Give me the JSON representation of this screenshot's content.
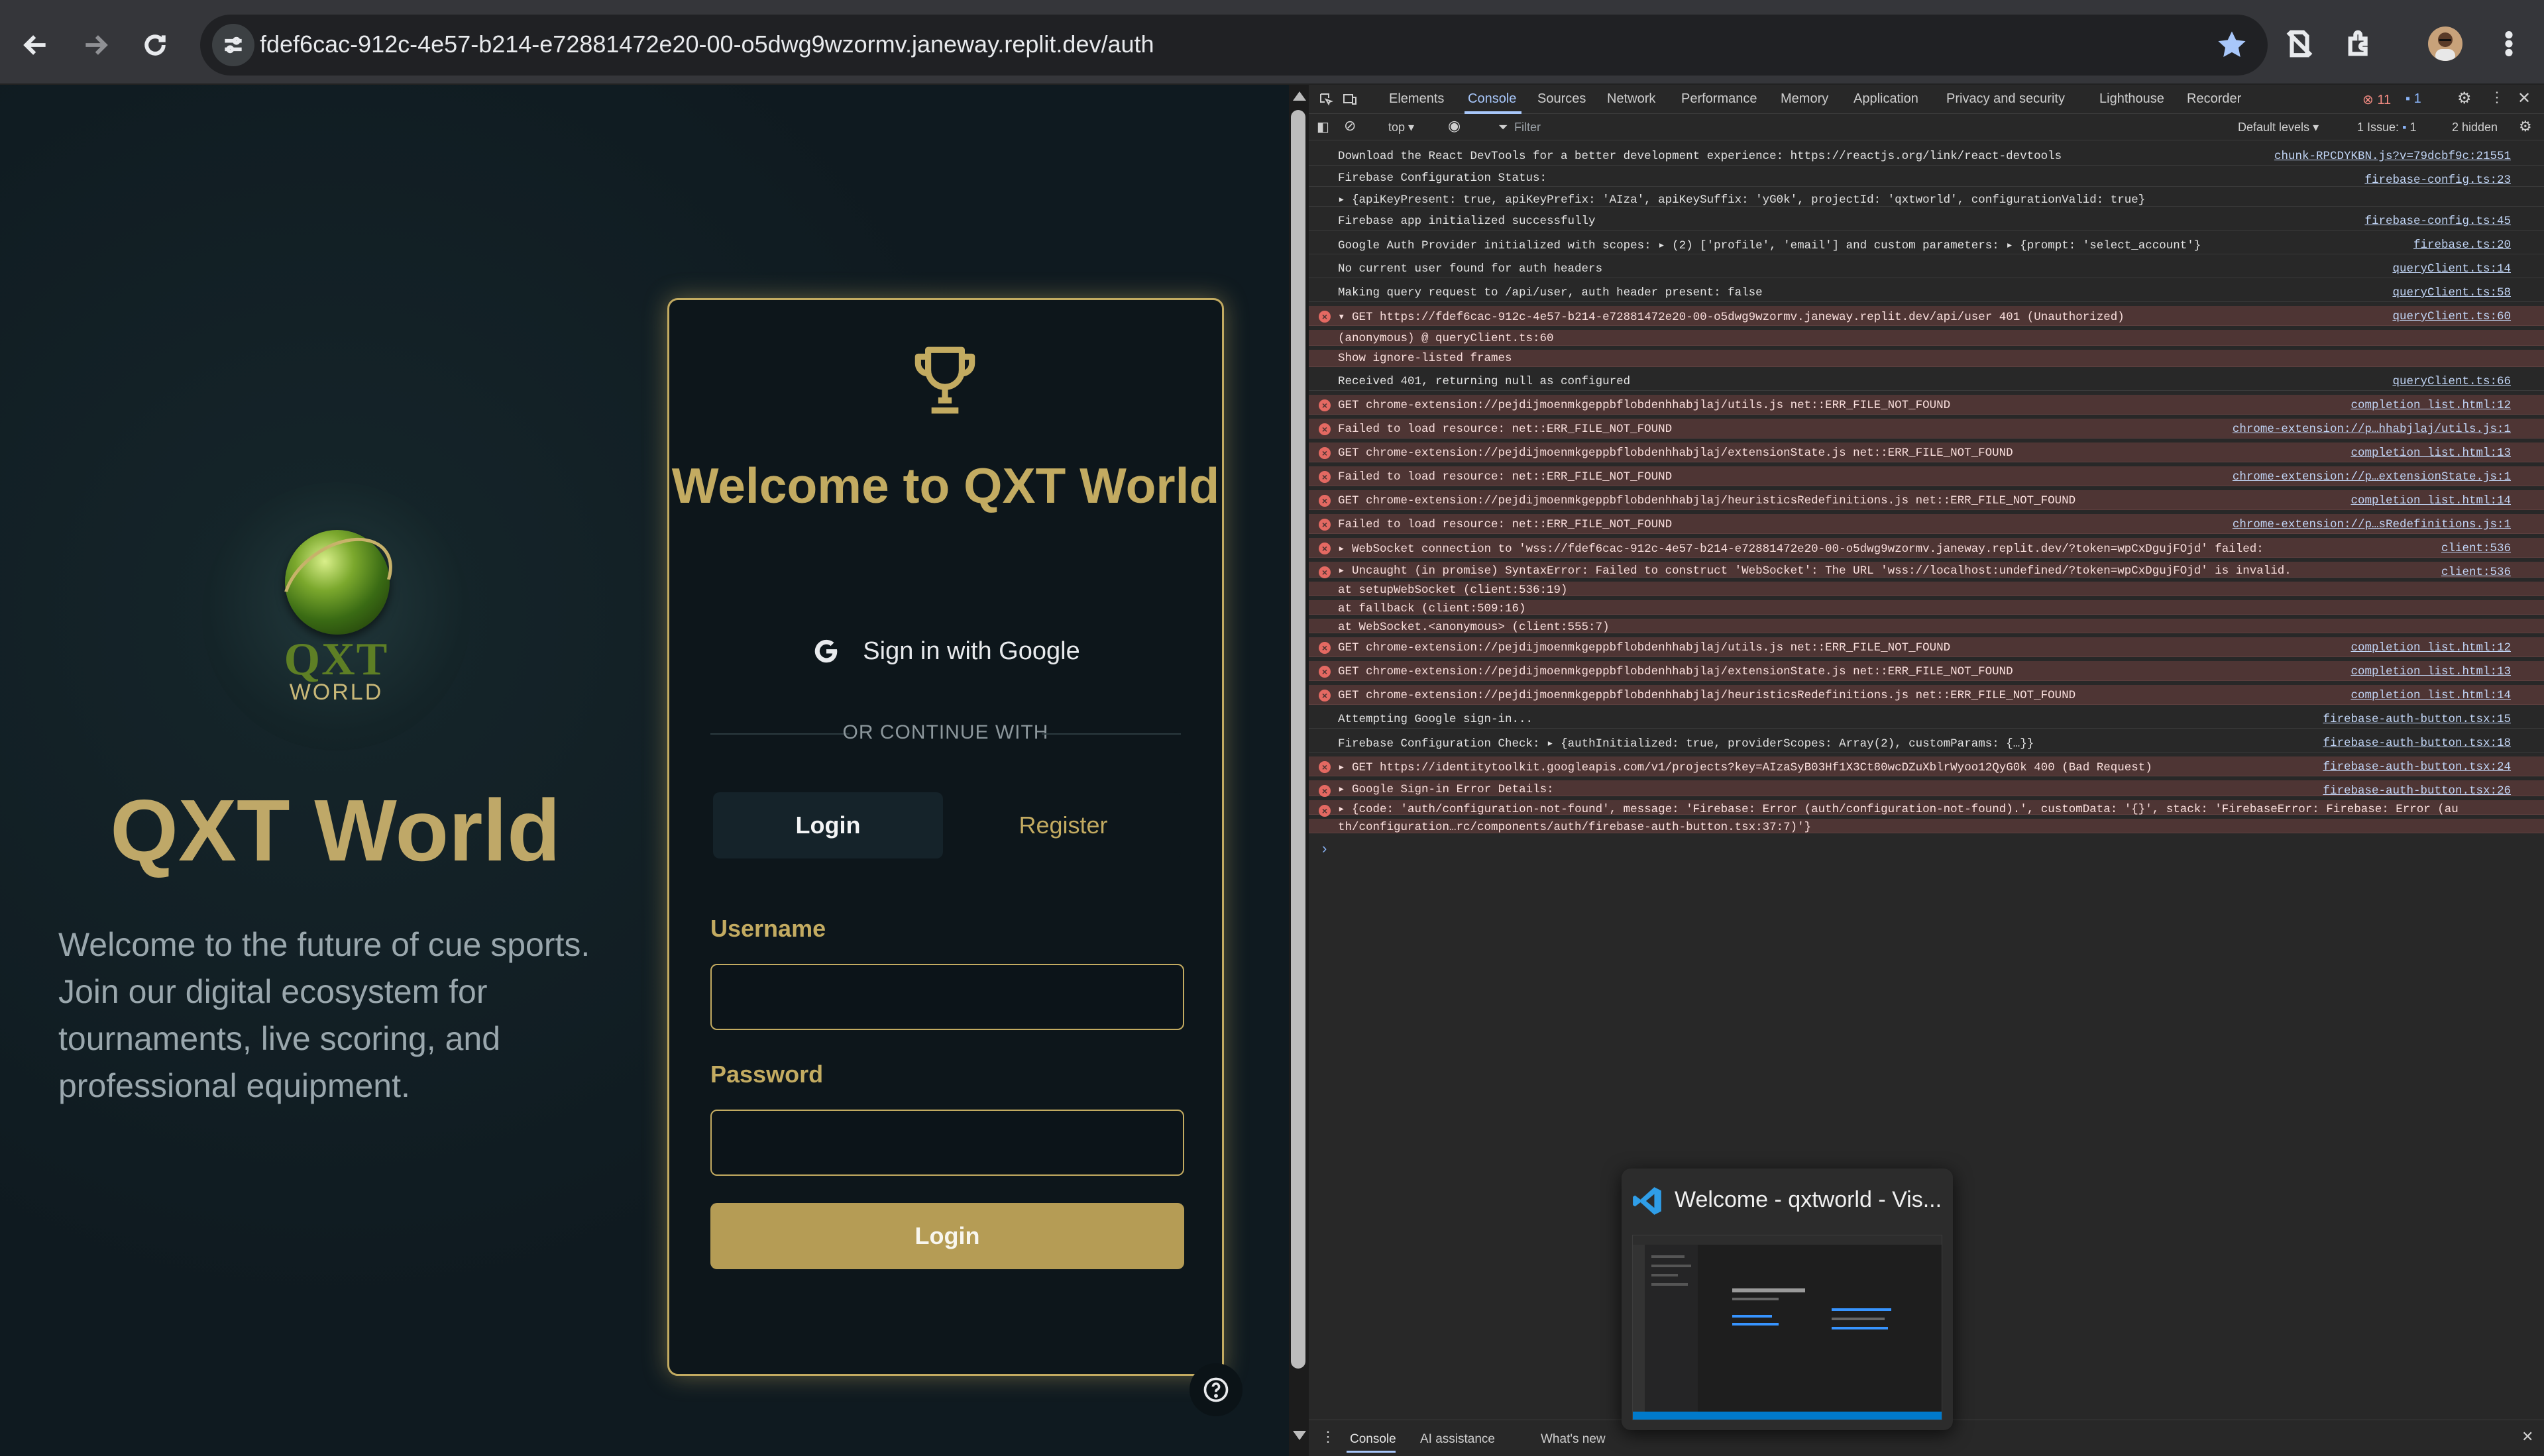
{
  "browser": {
    "url": "fdef6cac-912c-4e57-b214-e72881472e20-00-o5dwg9wzormv.janeway.replit.dev/auth"
  },
  "app": {
    "logo_text_top": "QXT",
    "logo_text_bottom": "WORLD",
    "brand_title": "QXT World",
    "brand_description": "Welcome to the future of cue sports. Join our digital ecosystem for tournaments, live scoring, and professional equipment.",
    "card": {
      "title": "Welcome to QXT World",
      "google_button": "Sign in with Google",
      "divider": "OR CONTINUE WITH",
      "tabs": [
        "Login",
        "Register"
      ],
      "username_label": "Username",
      "password_label": "Password",
      "submit": "Login"
    },
    "colors": {
      "gold": "#c3ab61",
      "background": "#0f1a20"
    }
  },
  "devtools": {
    "tabs": [
      "Elements",
      "Console",
      "Sources",
      "Network",
      "Performance",
      "Memory",
      "Application",
      "Privacy and security",
      "Lighthouse",
      "Recorder"
    ],
    "error_count": "11",
    "issue_count": "1",
    "context": "top",
    "filter_placeholder": "Filter",
    "levels": "Default levels",
    "issues_label": "1 Issue:",
    "issues_num": "1",
    "hidden": "2 hidden",
    "drawer_tabs": [
      "Console",
      "AI assistance",
      "What's new"
    ],
    "log": [
      {
        "type": "info",
        "msg": "Download the React DevTools for a better development experience: https://reactjs.org/link/react-devtools",
        "src": "chunk-RPCDYKBN.js?v=79dcbf9c:21551"
      },
      {
        "type": "info",
        "msg": "Firebase Configuration Status:",
        "src": "firebase-config.ts:23"
      },
      {
        "type": "info",
        "msg": "  ▸ {apiKeyPresent: true, apiKeyPrefix: 'AIza', apiKeySuffix: 'yG0k', projectId: 'qxtworld', configurationValid: true}",
        "src": ""
      },
      {
        "type": "info",
        "msg": "Firebase app initialized successfully",
        "src": "firebase-config.ts:45"
      },
      {
        "type": "info",
        "msg": "Google Auth Provider initialized with scopes:  ▸ (2) ['profile', 'email'] and custom parameters:  ▸ {prompt: 'select_account'}",
        "src": "firebase.ts:20"
      },
      {
        "type": "info",
        "msg": "No current user found for auth headers",
        "src": "queryClient.ts:14"
      },
      {
        "type": "info",
        "msg": "Making query request to /api/user, auth header present: false",
        "src": "queryClient.ts:58"
      },
      {
        "type": "error",
        "msg": "▾ GET https://fdef6cac-912c-4e57-b214-e72881472e20-00-o5dwg9wzormv.janeway.replit.dev/api/user 401 (Unauthorized)",
        "src": "queryClient.ts:60"
      },
      {
        "type": "error",
        "msg": "  (anonymous) @ queryClient.ts:60",
        "src": ""
      },
      {
        "type": "error",
        "msg": "  Show ignore-listed frames",
        "src": ""
      },
      {
        "type": "info",
        "msg": "Received 401, returning null as configured",
        "src": "queryClient.ts:66"
      },
      {
        "type": "error",
        "msg": "GET chrome-extension://pejdijmoenmkgeppbflobdenhhabjlaj/utils.js net::ERR_FILE_NOT_FOUND",
        "src": "completion_list.html:12"
      },
      {
        "type": "error",
        "msg": "Failed to load resource: net::ERR_FILE_NOT_FOUND",
        "src": "chrome-extension://p…hhabjlaj/utils.js:1"
      },
      {
        "type": "error",
        "msg": "GET chrome-extension://pejdijmoenmkgeppbflobdenhhabjlaj/extensionState.js net::ERR_FILE_NOT_FOUND",
        "src": "completion_list.html:13"
      },
      {
        "type": "error",
        "msg": "Failed to load resource: net::ERR_FILE_NOT_FOUND",
        "src": "chrome-extension://p…extensionState.js:1"
      },
      {
        "type": "error",
        "msg": "GET chrome-extension://pejdijmoenmkgeppbflobdenhhabjlaj/heuristicsRedefinitions.js net::ERR_FILE_NOT_FOUND",
        "src": "completion_list.html:14"
      },
      {
        "type": "error",
        "msg": "Failed to load resource: net::ERR_FILE_NOT_FOUND",
        "src": "chrome-extension://p…sRedefinitions.js:1"
      },
      {
        "type": "error",
        "msg": "▸ WebSocket connection to 'wss://fdef6cac-912c-4e57-b214-e72881472e20-00-o5dwg9wzormv.janeway.replit.dev/?token=wpCxDgujFOjd' failed:",
        "src": "client:536"
      },
      {
        "type": "error",
        "msg": "▸ Uncaught (in promise) SyntaxError: Failed to construct 'WebSocket': The URL 'wss://localhost:undefined/?token=wpCxDgujFOjd' is invalid.",
        "src": "client:536"
      },
      {
        "type": "error",
        "msg": "    at setupWebSocket (client:536:19)",
        "src": ""
      },
      {
        "type": "error",
        "msg": "    at fallback (client:509:16)",
        "src": ""
      },
      {
        "type": "error",
        "msg": "    at WebSocket.<anonymous> (client:555:7)",
        "src": ""
      },
      {
        "type": "error",
        "msg": "GET chrome-extension://pejdijmoenmkgeppbflobdenhhabjlaj/utils.js net::ERR_FILE_NOT_FOUND",
        "src": "completion_list.html:12"
      },
      {
        "type": "error",
        "msg": "GET chrome-extension://pejdijmoenmkgeppbflobdenhhabjlaj/extensionState.js net::ERR_FILE_NOT_FOUND",
        "src": "completion_list.html:13"
      },
      {
        "type": "error",
        "msg": "GET chrome-extension://pejdijmoenmkgeppbflobdenhhabjlaj/heuristicsRedefinitions.js net::ERR_FILE_NOT_FOUND",
        "src": "completion_list.html:14"
      },
      {
        "type": "info",
        "msg": "Attempting Google sign-in...",
        "src": "firebase-auth-button.tsx:15"
      },
      {
        "type": "info",
        "msg": "Firebase Configuration Check:  ▸ {authInitialized: true, providerScopes: Array(2), customParams: {…}}",
        "src": "firebase-auth-button.tsx:18"
      },
      {
        "type": "error",
        "msg": "▸ GET https://identitytoolkit.googleapis.com/v1/projects?key=AIzaSyB03Hf1X3Ct80wcDZuXblrWyoo12QyG0k 400 (Bad Request)",
        "src": "firebase-auth-button.tsx:24"
      },
      {
        "type": "error",
        "msg": "▸ Google Sign-in Error Details:",
        "src": "firebase-auth-button.tsx:26"
      },
      {
        "type": "error",
        "msg": "▸ {code: 'auth/configuration-not-found', message: 'Firebase: Error (auth/configuration-not-found).', customData: '{}', stack: 'FirebaseError: Firebase: Error (au",
        "src": ""
      },
      {
        "type": "error",
        "msg": "  th/configuration…rc/components/auth/firebase-auth-button.tsx:37:7)'}",
        "src": ""
      }
    ]
  },
  "taskbar_preview": {
    "title": "Welcome - qxtworld - Vis..."
  }
}
